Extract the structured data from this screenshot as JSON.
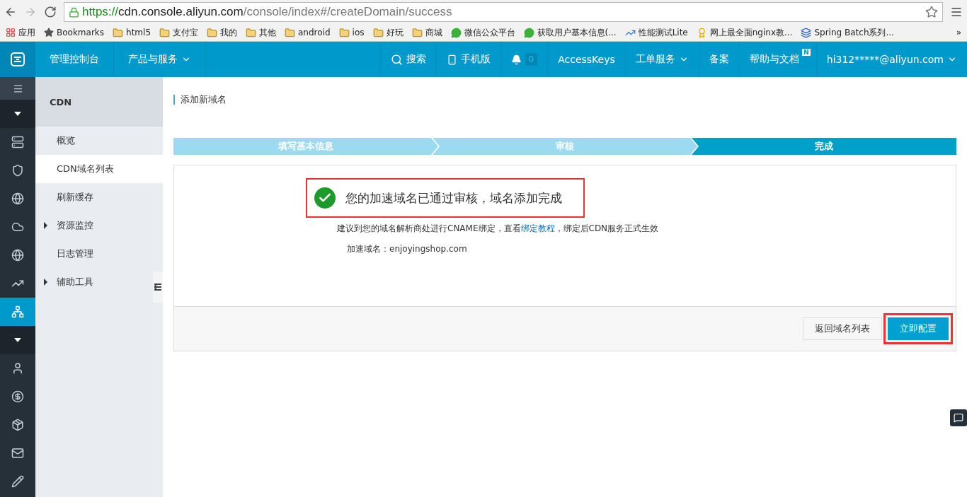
{
  "browser": {
    "url_scheme": "https://",
    "url_host": "cdn.console.aliyun.com",
    "url_path": "/console/index#/createDomain/success",
    "bookmarks": [
      {
        "kind": "apps",
        "label": "应用"
      },
      {
        "kind": "star",
        "label": "Bookmarks"
      },
      {
        "kind": "folder",
        "label": "html5"
      },
      {
        "kind": "folder",
        "label": "支付宝"
      },
      {
        "kind": "folder",
        "label": "我的"
      },
      {
        "kind": "folder",
        "label": "其他"
      },
      {
        "kind": "folder",
        "label": "android"
      },
      {
        "kind": "folder",
        "label": "ios"
      },
      {
        "kind": "folder",
        "label": "好玩"
      },
      {
        "kind": "folder",
        "label": "商城"
      },
      {
        "kind": "chat",
        "label": "微信公众平台"
      },
      {
        "kind": "chat",
        "label": "获取用户基本信息(..."
      },
      {
        "kind": "trend",
        "label": "性能测试Lite"
      },
      {
        "kind": "badge",
        "label": "网上最全面nginx教..."
      },
      {
        "kind": "spring",
        "label": "Spring Batch系列..."
      }
    ],
    "overflow": "»"
  },
  "header": {
    "console": "管理控制台",
    "products": "产品与服务",
    "search": "搜索",
    "mobile": "手机版",
    "notifications": "0",
    "access_keys": "AccessKeys",
    "tickets": "工单服务",
    "filing": "备案",
    "help": "帮助与文档",
    "help_badge": "N",
    "account": "hi312*****@aliyun.com"
  },
  "rail": [
    {
      "kind": "menu",
      "selected": false
    },
    {
      "kind": "toggle",
      "selected": false
    },
    {
      "kind": "icon",
      "selected": false
    },
    {
      "kind": "icon",
      "selected": false
    },
    {
      "kind": "icon",
      "selected": false
    },
    {
      "kind": "icon",
      "selected": false
    },
    {
      "kind": "icon",
      "selected": false
    },
    {
      "kind": "icon",
      "selected": false
    },
    {
      "kind": "icon",
      "selected": true
    },
    {
      "kind": "toggle",
      "selected": false
    },
    {
      "kind": "icon",
      "selected": false
    },
    {
      "kind": "icon",
      "selected": false
    },
    {
      "kind": "icon",
      "selected": false
    },
    {
      "kind": "icon",
      "selected": false
    },
    {
      "kind": "icon",
      "selected": false
    }
  ],
  "menu": {
    "title": "CDN",
    "items": [
      {
        "label": "概览",
        "selected": false,
        "expandable": false
      },
      {
        "label": "CDN域名列表",
        "selected": true,
        "expandable": false
      },
      {
        "label": "刷新缓存",
        "selected": false,
        "expandable": false
      },
      {
        "label": "资源监控",
        "selected": false,
        "expandable": true
      },
      {
        "label": "日志管理",
        "selected": false,
        "expandable": false
      },
      {
        "label": "辅助工具",
        "selected": false,
        "expandable": true
      }
    ]
  },
  "page": {
    "title": "添加新域名",
    "steps": [
      {
        "label": "填写基本信息",
        "selected": false
      },
      {
        "label": "审核",
        "selected": false
      },
      {
        "label": "完成",
        "selected": true
      }
    ],
    "message": "您的加速域名已通过审核，域名添加完成",
    "hint_before": "建议到您的域名解析商处进行CNAME绑定，直看",
    "hint_link": "绑定教程",
    "hint_after": "，绑定后CDN服务正式生效",
    "domain": "加速域名：enjoyingshop.com",
    "buttons": [
      {
        "label": "返回域名列表",
        "kind": "secondary"
      },
      {
        "label": "立即配置",
        "kind": "primary"
      }
    ]
  }
}
